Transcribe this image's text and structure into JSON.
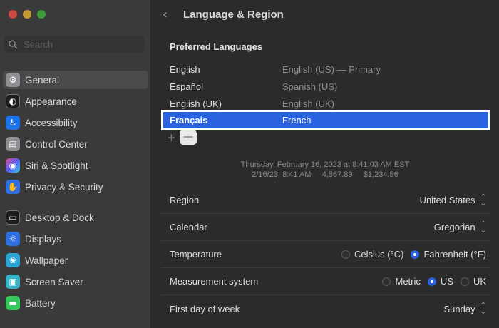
{
  "window": {
    "title": "Language & Region"
  },
  "sidebar": {
    "search_placeholder": "Search",
    "items": [
      {
        "label": "General",
        "icon": "gear-icon",
        "color": "#8e8e93"
      },
      {
        "label": "Appearance",
        "icon": "appearance-icon",
        "color": "#1c1c1e"
      },
      {
        "label": "Accessibility",
        "icon": "accessibility-icon",
        "color": "#1a73e8"
      },
      {
        "label": "Control Center",
        "icon": "control-center-icon",
        "color": "#8e8e93"
      },
      {
        "label": "Siri & Spotlight",
        "icon": "siri-icon",
        "color": "#b03cd6"
      },
      {
        "label": "Privacy & Security",
        "icon": "hand-icon",
        "color": "#2f6fe0"
      },
      {
        "label": "Desktop & Dock",
        "icon": "dock-icon",
        "color": "#1c1c1e"
      },
      {
        "label": "Displays",
        "icon": "displays-icon",
        "color": "#2f6fe0"
      },
      {
        "label": "Wallpaper",
        "icon": "wallpaper-icon",
        "color": "#2aa6d6"
      },
      {
        "label": "Screen Saver",
        "icon": "screen-saver-icon",
        "color": "#35b4c8"
      },
      {
        "label": "Battery",
        "icon": "battery-icon",
        "color": "#34c759"
      }
    ]
  },
  "preferred_languages": {
    "title": "Preferred Languages",
    "rows": [
      {
        "name": "English",
        "detail": "English (US) — Primary"
      },
      {
        "name": "Español",
        "detail": "Spanish (US)"
      },
      {
        "name": "English (UK)",
        "detail": "English (UK)"
      },
      {
        "name": "Français",
        "detail": "French"
      }
    ],
    "add_label": "+",
    "remove_label": "—"
  },
  "format_sample": {
    "line1": "Thursday, February 16, 2023 at 8:41:03 AM EST",
    "line2": "2/16/23, 8:41 AM     4,567.89     $1,234.56"
  },
  "settings": {
    "region": {
      "label": "Region",
      "value": "United States"
    },
    "calendar": {
      "label": "Calendar",
      "value": "Gregorian"
    },
    "temperature": {
      "label": "Temperature",
      "options": [
        "Celsius (°C)",
        "Fahrenheit (°F)"
      ],
      "selected": "Fahrenheit (°F)"
    },
    "measurement": {
      "label": "Measurement system",
      "options": [
        "Metric",
        "US",
        "UK"
      ],
      "selected": "US"
    },
    "first_day": {
      "label": "First day of week",
      "value": "Sunday"
    }
  },
  "glyphs": {
    "back": "‹",
    "chevron_up": "⌃",
    "chevron_down": "⌄"
  },
  "colors": {
    "accent": "#2a63e0",
    "highlight_border": "#ffffff"
  }
}
